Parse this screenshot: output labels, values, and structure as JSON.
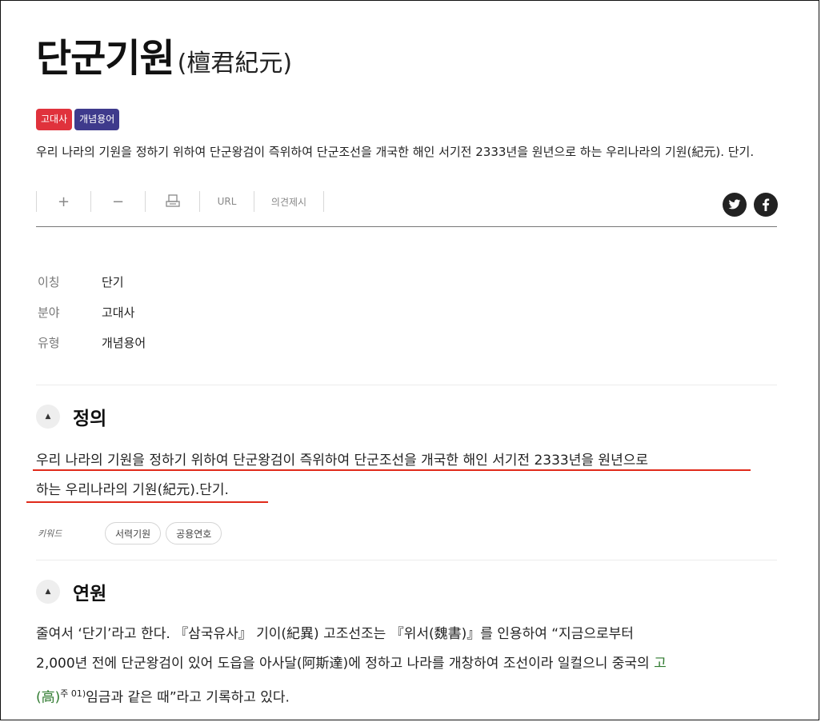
{
  "title": {
    "main": "단군기원",
    "hanja": "(檀君紀元)"
  },
  "badges": [
    {
      "label": "고대사",
      "color": "#e0323c"
    },
    {
      "label": "개념용어",
      "color": "#3e3a8c"
    }
  ],
  "summary": " 우리 나라의 기원을 정하기 위하여 단군왕검이 즉위하여 단군조선을 개국한 해인 서기전 2333년을 원년으로 하는 우리나라의 기원(紀元).   단기.",
  "toolbar": {
    "zoom_in": "+",
    "zoom_out": "−",
    "print_icon": "print-icon",
    "url": "URL",
    "feedback": "의견제시"
  },
  "social": [
    "twitter-icon",
    "facebook-icon"
  ],
  "meta": [
    {
      "key": "이칭",
      "value": "단기"
    },
    {
      "key": "분야",
      "value": "고대사"
    },
    {
      "key": "유형",
      "value": "개념용어"
    }
  ],
  "definition": {
    "icon": "▲",
    "title": "정의",
    "line1": "우리 나라의 기원을 정하기 위하여 단군왕검이 즉위하여 단군조선을 개국한 해인 서기전 2333년을 원년으로",
    "line2": "하는 우리나라의 기원(紀元).단기.",
    "keyword_label": "키워드",
    "keywords": [
      "서력기원",
      "공용연호"
    ]
  },
  "origin": {
    "icon": "▲",
    "title": "연원",
    "line1": "줄여서 ‘단기’라고 한다. 『삼국유사』 기이(紀異) 고조선조는 『위서(魏書)』를 인용하여 “지금으로부터",
    "line2_a": "2,000년 전에 단군왕검이 있어 도읍을 아사달(阿斯達)에 정하고 나라를 개창하여 조선이라 일컬으니 중국의 ",
    "line2_link": "고",
    "line3_link": "(高)",
    "footnote": "주 01)",
    "line3_b": "임금과 같은 때”라고 기록하고 있다."
  },
  "colors": {
    "accent_red": "#e02a1a",
    "link_green": "#2f7a2f"
  }
}
